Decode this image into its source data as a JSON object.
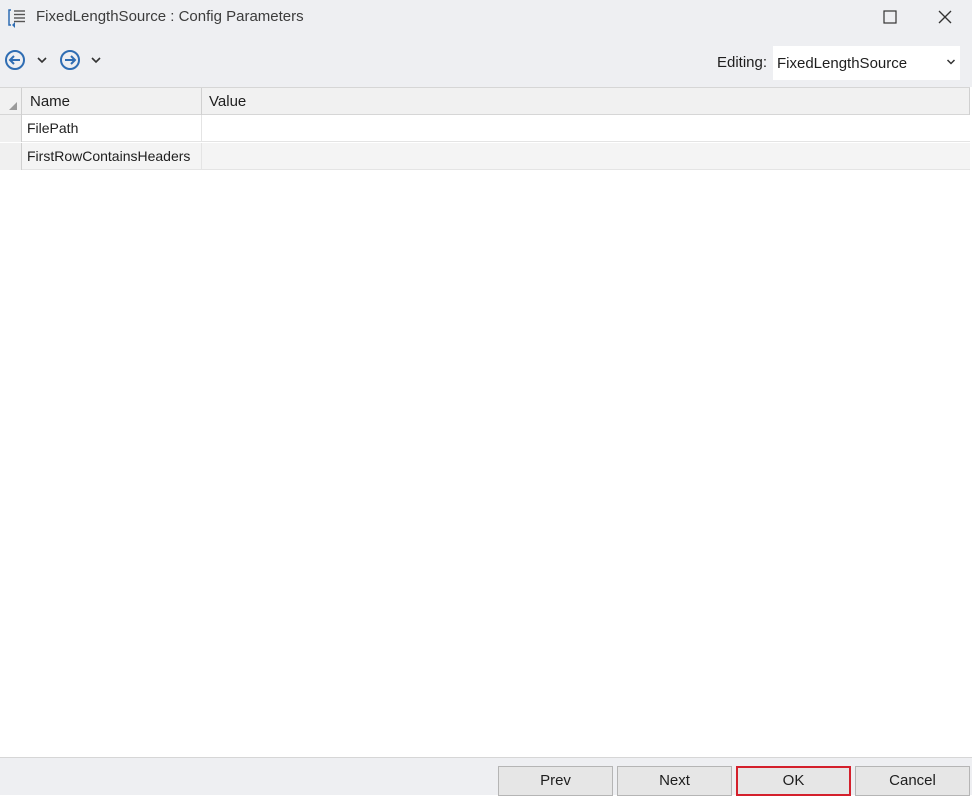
{
  "window": {
    "title": "FixedLengthSource : Config Parameters",
    "app_icon": "config-list-icon",
    "controls": {
      "maximize_icon": "maximize-icon",
      "close_icon": "close-icon"
    }
  },
  "toolbar": {
    "back_icon": "arrow-left-circle-icon",
    "forward_icon": "arrow-right-circle-icon",
    "editing_label": "Editing:",
    "editing_value": "FixedLengthSource"
  },
  "grid": {
    "columns": [
      "Name",
      "Value"
    ],
    "rows": [
      {
        "name": "FilePath",
        "value": ""
      },
      {
        "name": "FirstRowContainsHeaders",
        "value": ""
      }
    ]
  },
  "footer": {
    "prev_label": "Prev",
    "next_label": "Next",
    "ok_label": "OK",
    "cancel_label": "Cancel"
  },
  "colors": {
    "chrome_bg": "#eeeff2",
    "accent_blue": "#2f6db3",
    "focus_border": "#d4202c"
  }
}
